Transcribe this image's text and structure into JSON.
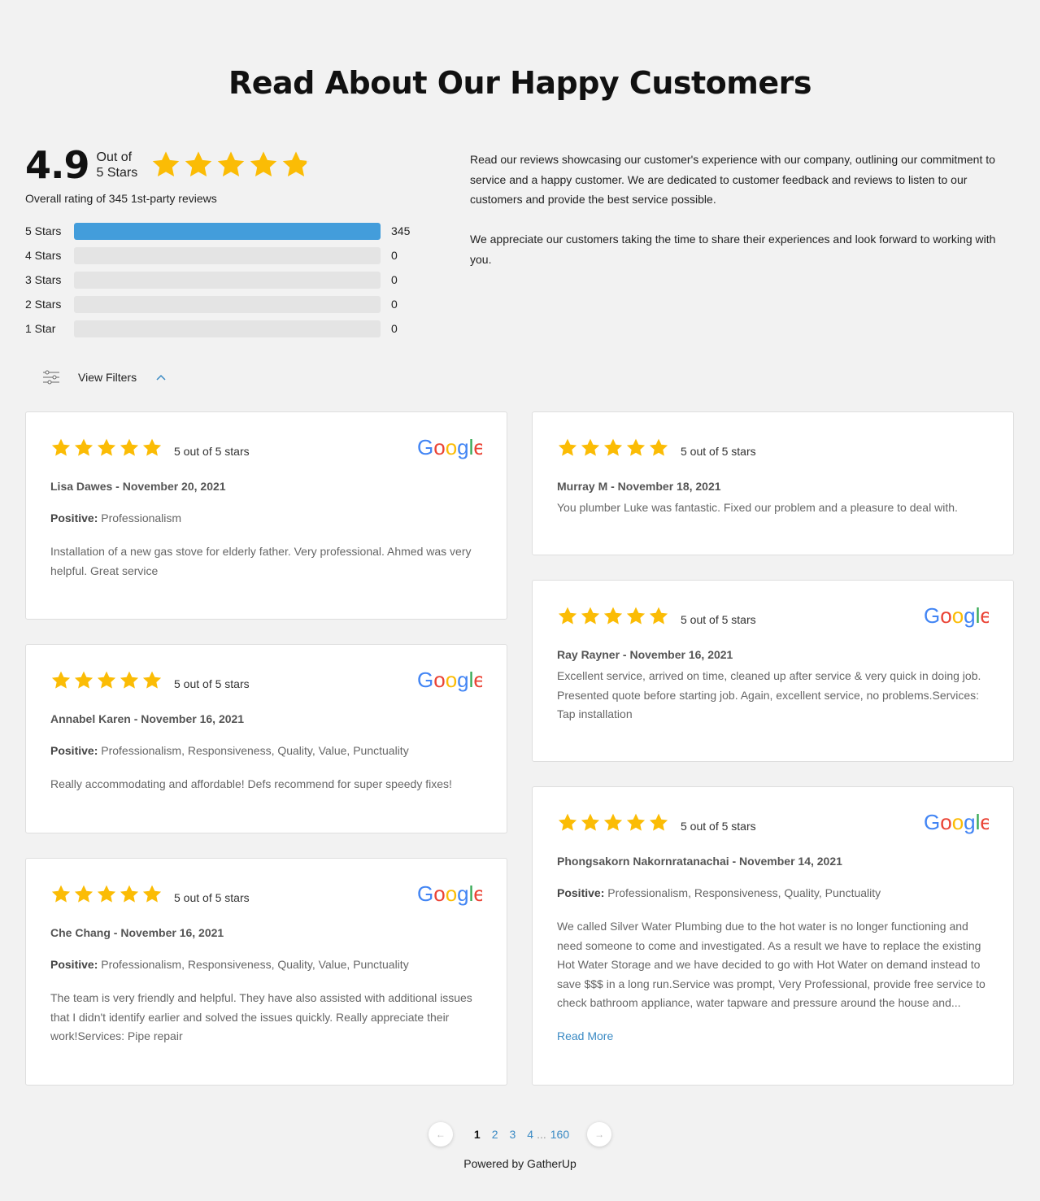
{
  "title": "Read About Our Happy Customers",
  "summary": {
    "score": "4.9",
    "out_of_line1": "Out of",
    "out_of_line2": "5 Stars",
    "star_rating": 4.9,
    "overall": "Overall rating of 345 1st-party reviews",
    "bars": [
      {
        "label": "5 Stars",
        "count": "345",
        "fraction": 1.0
      },
      {
        "label": "4 Stars",
        "count": "0",
        "fraction": 0
      },
      {
        "label": "3 Stars",
        "count": "0",
        "fraction": 0
      },
      {
        "label": "2 Stars",
        "count": "0",
        "fraction": 0
      },
      {
        "label": "1 Star",
        "count": "0",
        "fraction": 0
      }
    ]
  },
  "intro": {
    "p1": "Read our reviews showcasing our customer's experience with our company, outlining our commitment to service and a happy customer. We are dedicated to customer feedback and reviews to listen to our customers and provide the best service possible.",
    "p2": "We appreciate our customers taking the time to share their experiences and look forward to working with you."
  },
  "filters": {
    "label": "View Filters",
    "icon": "sliders-icon",
    "chevron": "chevron-up-icon"
  },
  "colors": {
    "star": "#fbbc05",
    "bar": "#439ddb",
    "link": "#3a8ac4"
  },
  "positive_label": "Positive:",
  "reviews": [
    {
      "rating_text": "5 out of 5 stars",
      "reviewer": "Lisa Dawes - November 20, 2021",
      "positive": "Professionalism",
      "text": "Installation of a new gas stove for elderly father. Very professional. Ahmed was very helpful. Great service",
      "source": "Google"
    },
    {
      "rating_text": "5 out of 5 stars",
      "reviewer": "Murray M - November 18, 2021",
      "text": "You plumber Luke was fantastic. Fixed our problem and a pleasure to deal with."
    },
    {
      "rating_text": "5 out of 5 stars",
      "reviewer": "Ray Rayner - November 16, 2021",
      "text": "Excellent service, arrived on time, cleaned up after service & very quick in doing job. Presented quote before starting job. Again, excellent service, no problems.Services: Tap installation",
      "source": "Google"
    },
    {
      "rating_text": "5 out of 5 stars",
      "reviewer": "Annabel Karen - November 16, 2021",
      "positive": "Professionalism, Responsiveness, Quality, Value, Punctuality",
      "text": "Really accommodating and affordable! Defs recommend for super speedy fixes!",
      "source": "Google"
    },
    {
      "rating_text": "5 out of 5 stars",
      "reviewer": "Phongsakorn Nakornratanachai - November 14, 2021",
      "positive": "Professionalism, Responsiveness, Quality, Punctuality",
      "text": "We called Silver Water Plumbing due to the hot water is no longer functioning and need someone to come and investigated. As a result we have to replace the existing Hot Water Storage and we have decided to go with Hot Water on demand instead to save $$$ in a long run.Service was prompt, Very Professional, provide free service to check bathroom appliance, water tapware and pressure around the house and...",
      "read_more": "Read More",
      "source": "Google"
    },
    {
      "rating_text": "5 out of 5 stars",
      "reviewer": "Che Chang - November 16, 2021",
      "positive": "Professionalism, Responsiveness, Quality, Value, Punctuality",
      "text": "The team is very friendly and helpful. They have also assisted with additional issues that I didn't identify earlier and solved the issues quickly. Really appreciate their work!Services: Pipe repair",
      "source": "Google"
    }
  ],
  "pagination": {
    "prev": "←",
    "next": "→",
    "pages": [
      "1",
      "2",
      "3",
      "4"
    ],
    "current": "1",
    "ellipsis": "...",
    "last": "160"
  },
  "footer": "Powered by GatherUp"
}
